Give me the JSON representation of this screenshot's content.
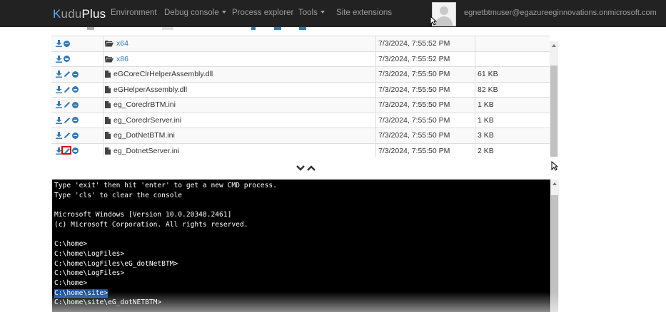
{
  "navbar": {
    "brand_prefix": "K",
    "brand_main": "udu",
    "brand_plus": "Plus",
    "items": [
      {
        "label": "Environment",
        "dropdown": false
      },
      {
        "label": "Debug console",
        "dropdown": true
      },
      {
        "label": "Process explorer",
        "dropdown": false
      },
      {
        "label": "Tools",
        "dropdown": true
      },
      {
        "label": "Site extensions",
        "dropdown": false
      }
    ],
    "user_email": "egnetbtmuser@egazureeginnovations.onmicrosoft.com"
  },
  "files": [
    {
      "type": "folder",
      "name": "x64",
      "modified": "7/3/2024, 7:55:52 PM",
      "size": "",
      "editable": false
    },
    {
      "type": "folder",
      "name": "x86",
      "modified": "7/3/2024, 7:55:52 PM",
      "size": "",
      "editable": false
    },
    {
      "type": "file",
      "name": "eGCoreClrHelperAssembly.dll",
      "modified": "7/3/2024, 7:55:50 PM",
      "size": "61 KB",
      "editable": true
    },
    {
      "type": "file",
      "name": "eGHelperAssembly.dll",
      "modified": "7/3/2024, 7:55:50 PM",
      "size": "82 KB",
      "editable": true
    },
    {
      "type": "file",
      "name": "eg_CoreclrBTM.ini",
      "modified": "7/3/2024, 7:55:50 PM",
      "size": "1 KB",
      "editable": true
    },
    {
      "type": "file",
      "name": "eg_CoreclrServer.ini",
      "modified": "7/3/2024, 7:55:50 PM",
      "size": "1 KB",
      "editable": true
    },
    {
      "type": "file",
      "name": "eg_DotNetBTM.ini",
      "modified": "7/3/2024, 7:55:50 PM",
      "size": "3 KB",
      "editable": true
    },
    {
      "type": "file",
      "name": "eg_DotnetServer.ini",
      "modified": "7/3/2024, 7:55:50 PM",
      "size": "2 KB",
      "editable": true
    }
  ],
  "highlighted_action": "edit eg_DotnetServer.ini",
  "console": {
    "lines": [
      "Type 'exit' then hit 'enter' to get a new CMD process.",
      "Type 'cls' to clear the console",
      "",
      "Microsoft Windows [Version 10.0.20348.2461]",
      "(c) Microsoft Corporation. All rights reserved.",
      "",
      "C:\\home>",
      "C:\\home\\LogFiles>",
      "C:\\home\\LogFiles\\eG_dotNetBTM>",
      "C:\\home\\LogFiles>",
      "C:\\home>",
      "C:\\home\\site>",
      "C:\\home\\site\\eG_dotNETBTM>"
    ],
    "selected_line_index": 11
  },
  "colors": {
    "navbar_bg": "#222222",
    "link_blue": "#337ab7",
    "console_bg": "#000000",
    "selection_blue": "#1a4fa3",
    "highlight_red": "#e00000"
  }
}
